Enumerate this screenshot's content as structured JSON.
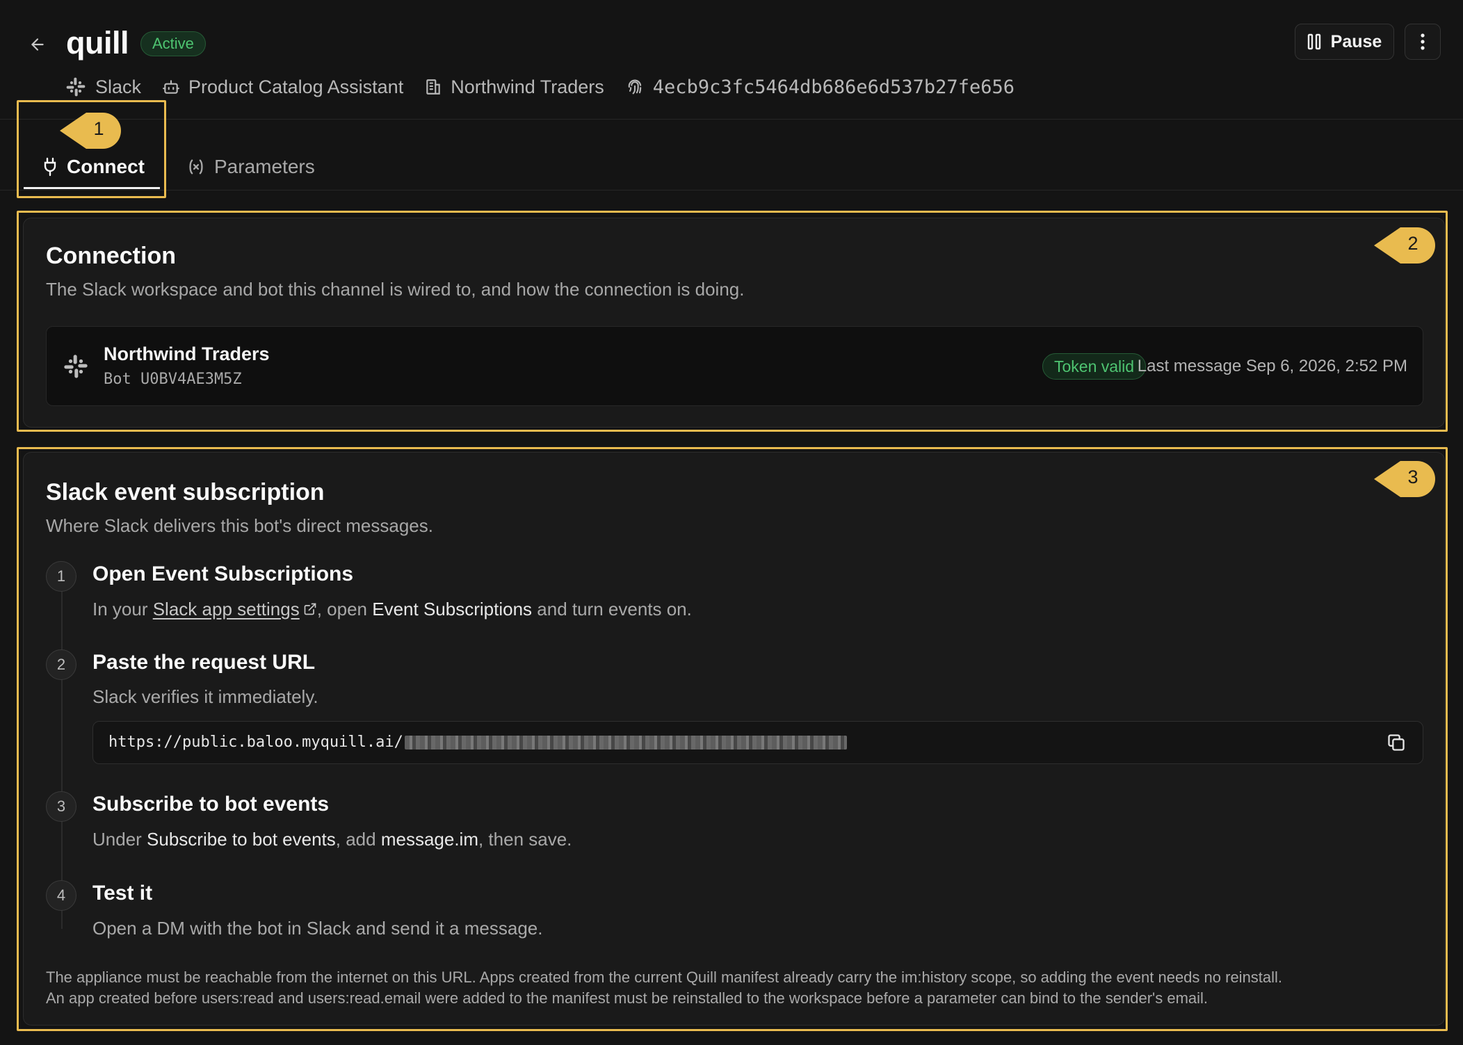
{
  "header": {
    "title": "quill",
    "status": "Active",
    "meta": {
      "platform": "Slack",
      "assistant": "Product Catalog Assistant",
      "organization": "Northwind Traders",
      "id": "4ecb9c3fc5464db686e6d537b27fe656"
    },
    "pause_label": "Pause"
  },
  "tabs": {
    "connect": "Connect",
    "parameters": "Parameters"
  },
  "markers": [
    "1",
    "2",
    "3"
  ],
  "connection": {
    "title": "Connection",
    "description": "The Slack workspace and bot this channel is wired to, and how the connection is doing.",
    "workspace": "Northwind Traders",
    "bot": "Bot U0BV4AE3M5Z",
    "token_status": "Token valid",
    "last_message": "Last message Sep 6, 2026, 2:52 PM"
  },
  "subscription": {
    "title": "Slack event subscription",
    "description": "Where Slack delivers this bot's direct messages.",
    "steps": [
      {
        "number": "1",
        "title": "Open Event Subscriptions",
        "text_before": "In your ",
        "link": "Slack app settings",
        "text_middle": ", open ",
        "emphasis": "Event Subscriptions",
        "text_after": " and turn events on."
      },
      {
        "number": "2",
        "title": "Paste the request URL",
        "text": "Slack verifies it immediately."
      },
      {
        "number": "3",
        "title": "Subscribe to bot events",
        "text_before": "Under ",
        "emphasis1": "Subscribe to bot events",
        "text_middle": ", add ",
        "emphasis2": "message.im",
        "text_after": ", then save."
      },
      {
        "number": "4",
        "title": "Test it",
        "text": "Open a DM with the bot in Slack and send it a message."
      }
    ],
    "url_prefix": "https://public.baloo.myquill.ai/",
    "footnote_line1": "The appliance must be reachable from the internet on this URL. Apps created from the current Quill manifest already carry the im:history scope, so adding the event needs no reinstall.",
    "footnote_line2": "An app created before users:read and users:read.email were added to the manifest must be reinstalled to the workspace before a parameter can bind to the sender's email."
  },
  "colors": {
    "accent_highlight": "#e9bb4f",
    "status_green": "#4ec471",
    "background": "#141414"
  }
}
